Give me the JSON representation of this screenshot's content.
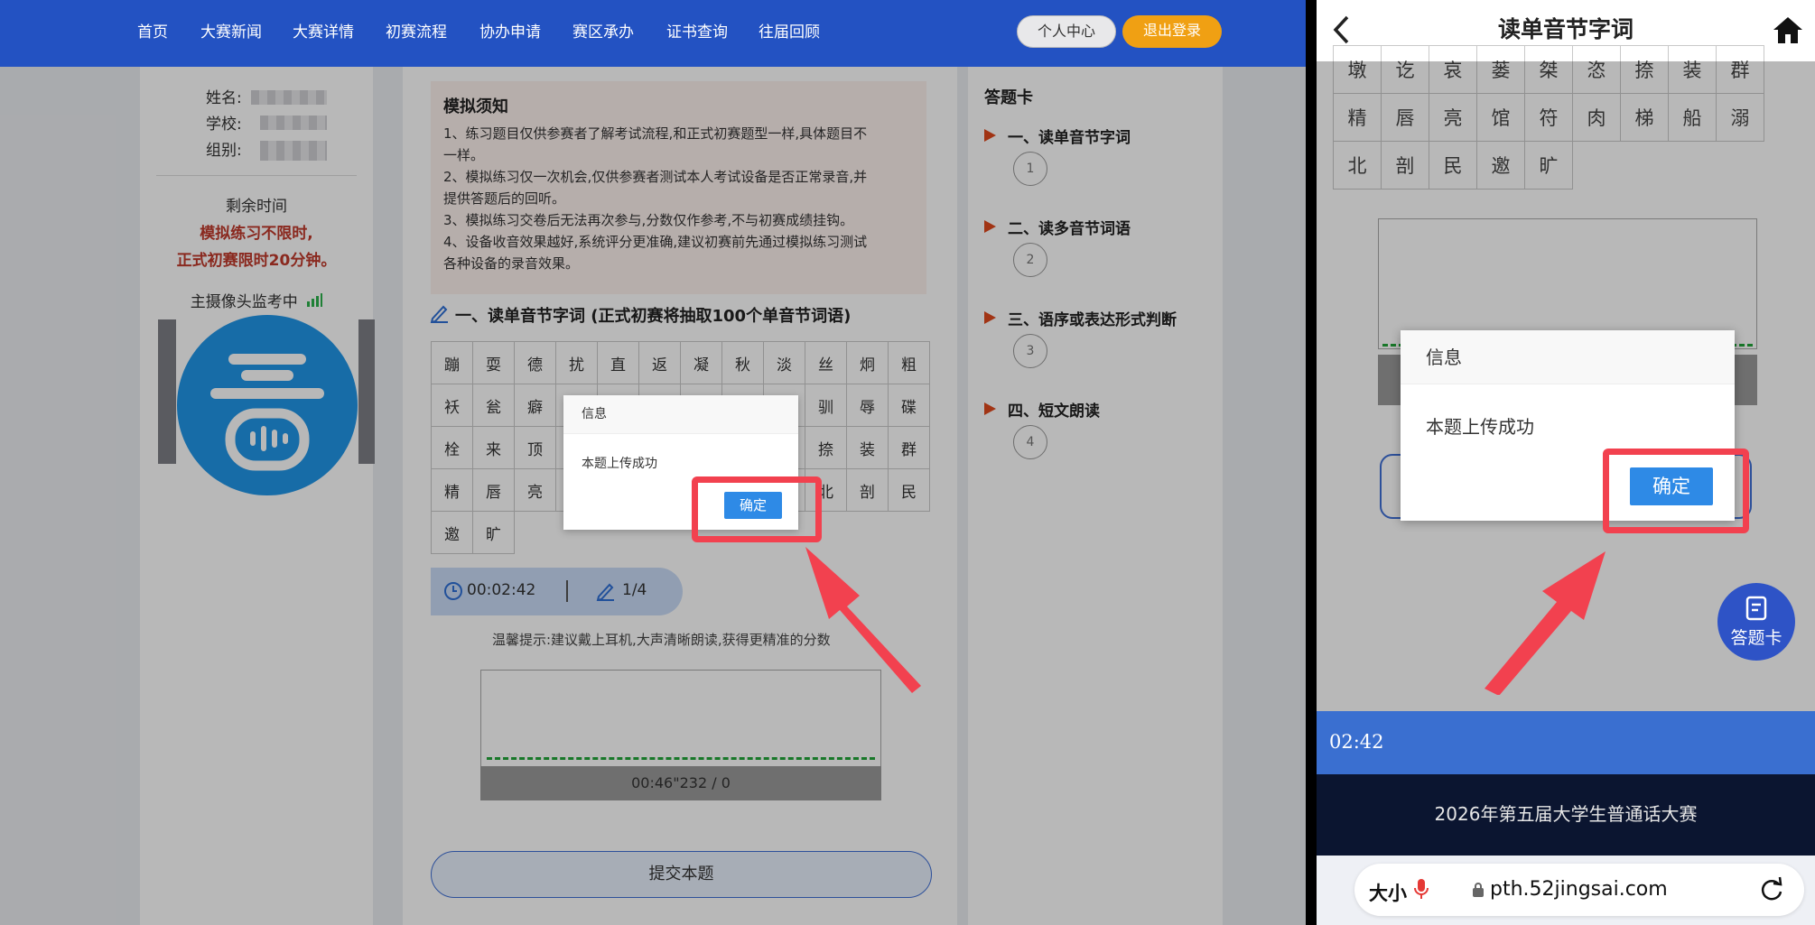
{
  "nav": {
    "items": [
      "首页",
      "大赛新闻",
      "大赛详情",
      "初赛流程",
      "协办申请",
      "赛区承办",
      "证书查询",
      "往届回顾"
    ],
    "profile_label": "个人中心",
    "logout_label": "退出登录"
  },
  "left_panel": {
    "name_label": "姓名:",
    "school_label": "学校:",
    "group_label": "组别:",
    "remaining_label": "剩余时间",
    "remaining_note_1": "模拟练习不限时,",
    "remaining_note_2": "正式初赛限时20分钟。",
    "camera_label": "主摄像头监考中",
    "logo_glyph": "普"
  },
  "notice": {
    "title": "模拟须知",
    "lines": [
      "1、练习题目仅供参赛者了解考试流程,和正式初赛题型一样,具体题目不",
      "一样。",
      "2、模拟练习仅一次机会,仅供参赛者测试本人考试设备是否正常录音,并",
      "提供答题后的回听。",
      "3、模拟练习交卷后无法再次参与,分数仅作参考,不与初赛成绩挂钩。",
      "4、设备收音效果越好,系统评分更准确,建议初赛前先通过模拟练习测试",
      "各种设备的录音效果。"
    ]
  },
  "section": {
    "title": "一、读单音节字词 (正式初赛将抽取100个单音节词语)",
    "grid_rows": [
      [
        "蹦",
        "耍",
        "德",
        "扰",
        "直",
        "返",
        "凝",
        "秋",
        "淡",
        "丝",
        "炯",
        "粗"
      ],
      [
        "袄",
        "瓮",
        "癖",
        "",
        "",
        "",
        "",
        "",
        "",
        "驯",
        "辱",
        "碟"
      ],
      [
        "栓",
        "来",
        "顶",
        "",
        "",
        "",
        "",
        "",
        "",
        "捺",
        "装",
        "群"
      ],
      [
        "精",
        "唇",
        "亮",
        "",
        "",
        "",
        "",
        "",
        "",
        "北",
        "剖",
        "民"
      ],
      [
        "邀",
        "旷"
      ]
    ]
  },
  "status": {
    "timer": "00:02:42",
    "progress": "1/4",
    "tip": "温馨提示:建议戴上耳机,大声清晰朗读,获得更精准的分数",
    "audio_time": "00:46\"232 / 0",
    "submit_label": "提交本题"
  },
  "answer_card": {
    "title": "答题卡",
    "sections": [
      {
        "label": "一、读单音节字词",
        "num": "1"
      },
      {
        "label": "二、读多音节词语",
        "num": "2"
      },
      {
        "label": "三、语序或表达形式判断",
        "num": "3"
      },
      {
        "label": "四、短文朗读",
        "num": "4"
      }
    ]
  },
  "dialog": {
    "title": "信息",
    "message": "本题上传成功",
    "ok_label": "确定"
  },
  "phone": {
    "title": "读单音节字词",
    "grid_rows": [
      [
        "墩",
        "讫",
        "哀",
        "蒌",
        "桀",
        "恣",
        "捺",
        "装",
        "群"
      ],
      [
        "精",
        "唇",
        "亮",
        "馆",
        "符",
        "肉",
        "梯",
        "船",
        "溺"
      ],
      [
        "北",
        "剖",
        "民",
        "邀",
        "旷"
      ]
    ],
    "fab_label": "答题卡",
    "timer": "02:42",
    "footer": "2026年第五届大学生普通话大赛",
    "text_size_label": "大小",
    "url": "pth.52jingsai.com"
  },
  "colors": {
    "nav_bg": "#2352c2",
    "accent_orange": "#f0a013",
    "highlight_red": "#c0392b",
    "button_blue": "#2e8ae6",
    "annotation_red": "#f2414f",
    "phone_bar": "#3a6fd0",
    "phone_footer": "#0b1530"
  }
}
